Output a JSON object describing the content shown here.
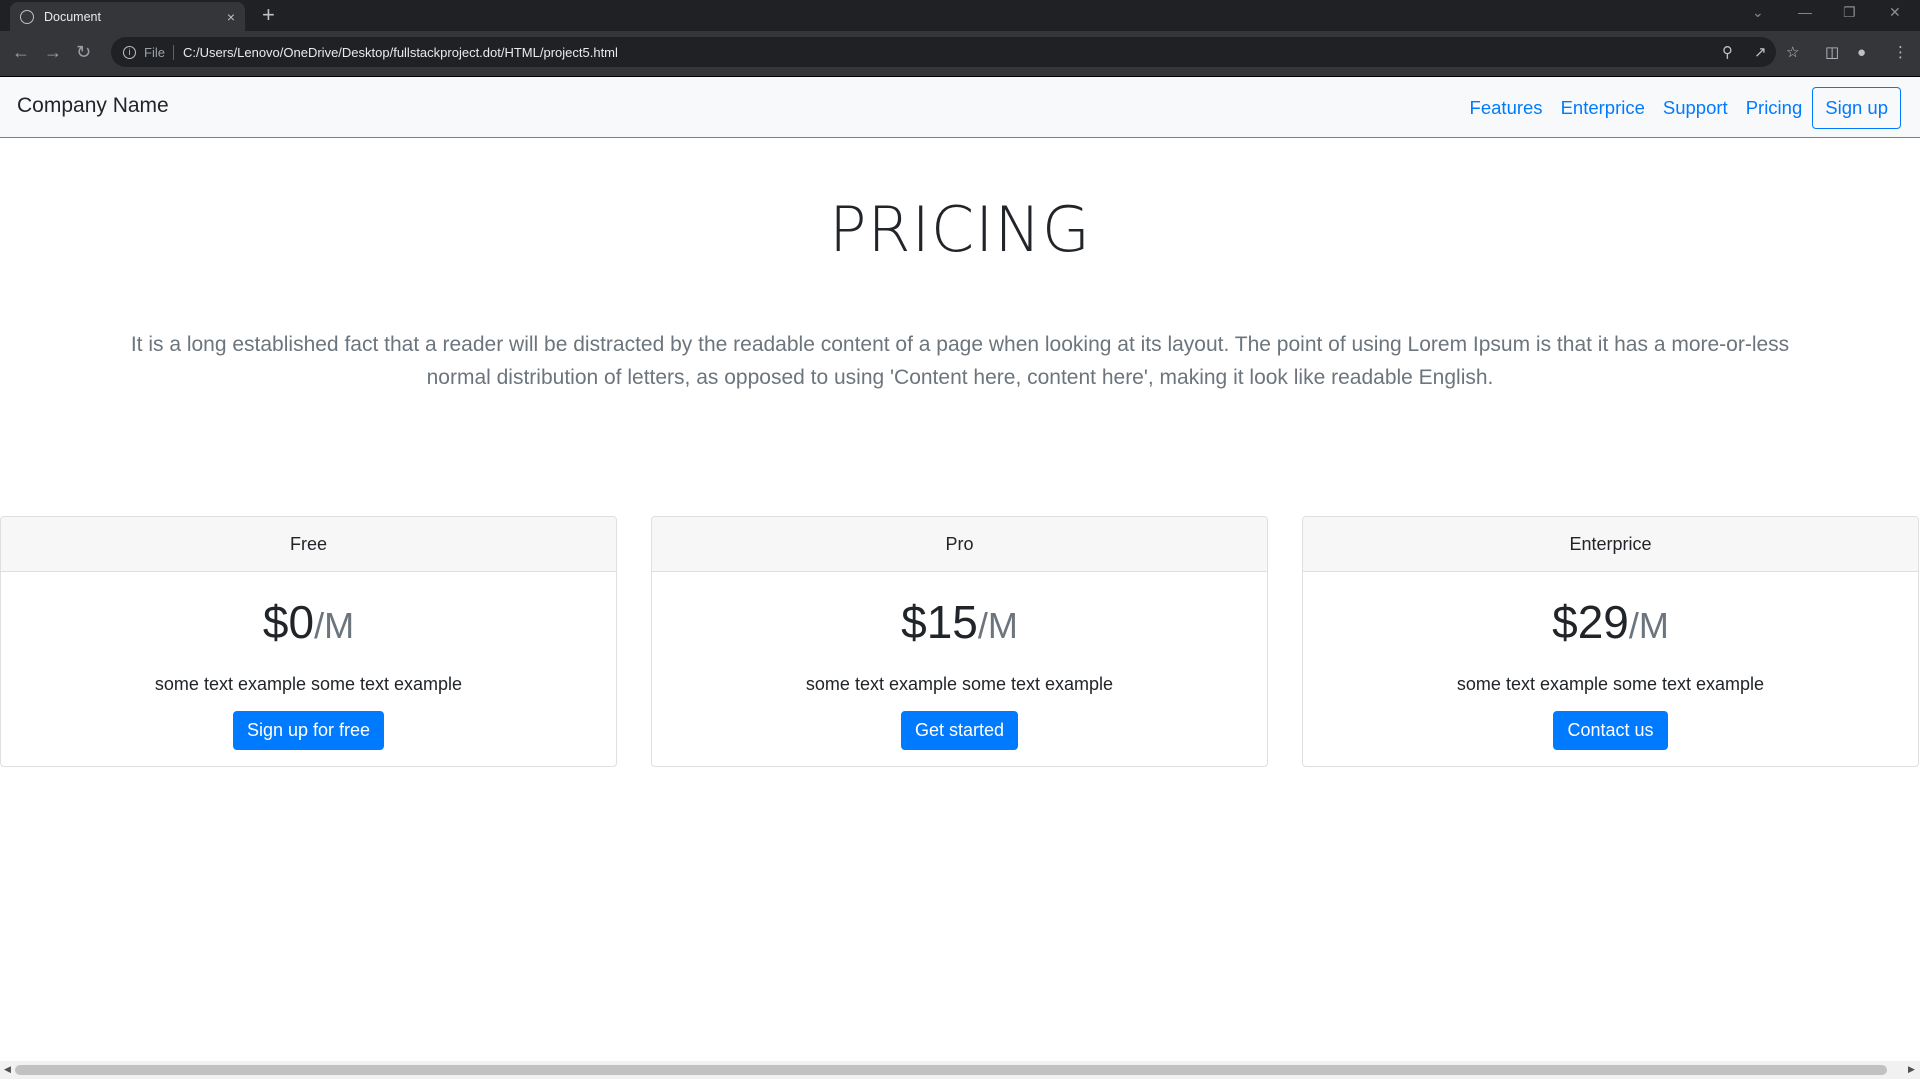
{
  "browser": {
    "tab_title": "Document",
    "tab_close": "×",
    "new_tab": "+",
    "scheme_label": "File",
    "url": "C:/Users/Lenovo/OneDrive/Desktop/fullstackproject.dot/HTML/project5.html",
    "icons": [
      "back-arrow-icon",
      "forward-arrow-icon",
      "reload-icon",
      "info-icon",
      "zoom-icon",
      "share-icon",
      "star-icon",
      "side-panel-icon",
      "profile-icon",
      "kebab-menu-icon"
    ]
  },
  "navbar": {
    "brand": "Company Name",
    "links": [
      "Features",
      "Enterprice",
      "Support",
      "Pricing"
    ],
    "signup_label": "Sign up"
  },
  "hero": {
    "title": "PRICING",
    "lead": "It is a long established fact that a reader will be distracted by the readable content of a page when looking at its layout. The point of using Lorem Ipsum is that it has a more-or-less normal distribution of letters, as opposed to using 'Content here, content here', making it look like readable English."
  },
  "plans": [
    {
      "name": "Free",
      "price": "$0",
      "per": "/M",
      "text": "some text example some text example",
      "button": "Sign up for free"
    },
    {
      "name": "Pro",
      "price": "$15",
      "per": "/M",
      "text": "some text example some text example",
      "button": "Get started"
    },
    {
      "name": "Enterprice",
      "price": "$29",
      "per": "/M",
      "text": "some text example some text example",
      "button": "Contact us"
    }
  ],
  "colors": {
    "accent": "#007bff",
    "navbar_bg": "#f8f9fa",
    "card_header_bg": "#f7f7f7",
    "muted_text": "#6c757d"
  }
}
